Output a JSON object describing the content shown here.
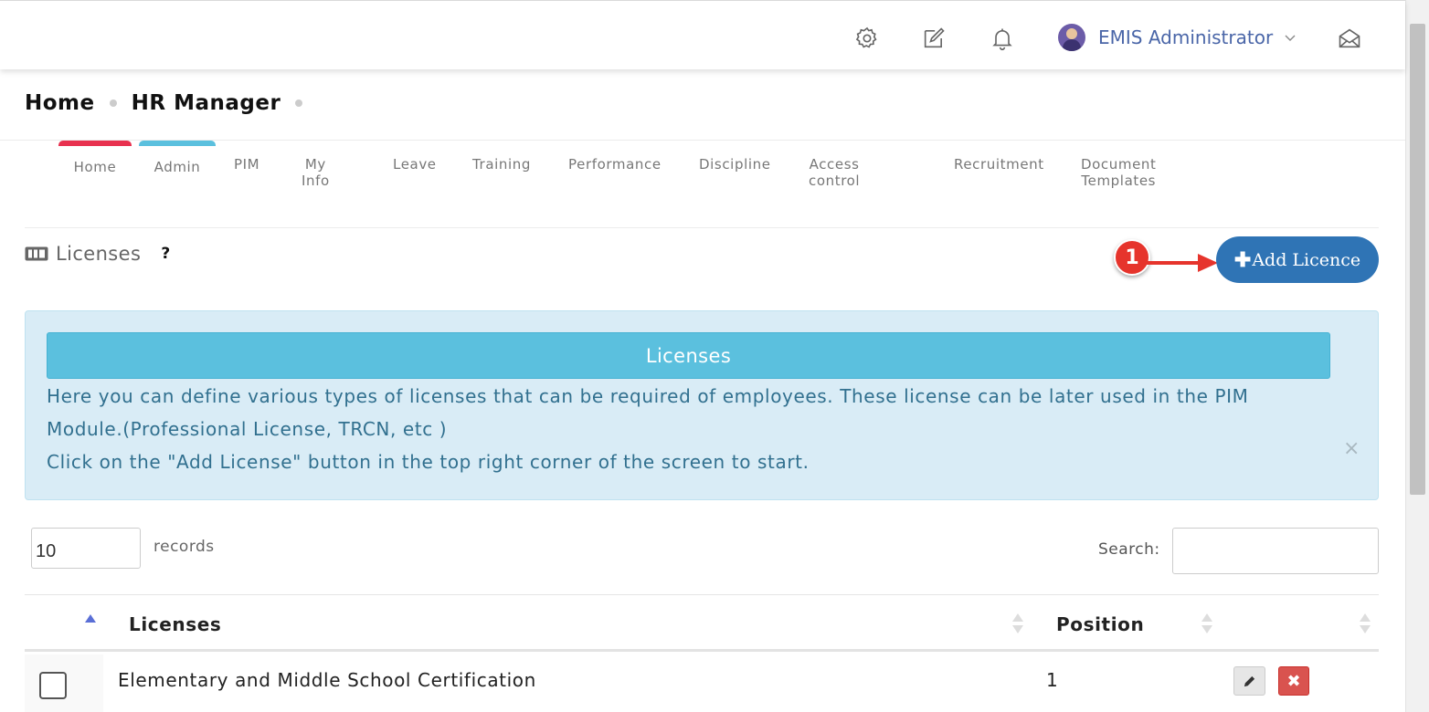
{
  "header": {
    "user_name": "EMIS Administrator"
  },
  "breadcrumb": {
    "home": "Home",
    "module": "HR Manager"
  },
  "tabs": [
    {
      "label": "Home",
      "accent": "#e8314f"
    },
    {
      "label": "Admin",
      "accent": "#5bc0de"
    },
    {
      "label": "PIM"
    },
    {
      "label": "My Info"
    },
    {
      "label": "Leave"
    },
    {
      "label": "Training"
    },
    {
      "label": "Performance"
    },
    {
      "label": "Discipline"
    },
    {
      "label": "Access control"
    },
    {
      "label": "Recruitment"
    },
    {
      "label": "Document Templates"
    }
  ],
  "page": {
    "title": "Licenses",
    "help": "?",
    "add_button": "Add Licence",
    "annotation_number": "1"
  },
  "alert": {
    "title": "Licenses",
    "line1": "Here you can define various types of licenses that can be required of employees. These license can be later used in the PIM Module.(Professional License, TRCN, etc )",
    "line2": "Click on the \"Add License\" button in the top right corner of the screen to start.",
    "close": "×"
  },
  "table_controls": {
    "page_length": "10",
    "records_label": "records",
    "search_label": "Search:",
    "search_value": ""
  },
  "table": {
    "columns": [
      "Licenses",
      "Position"
    ],
    "rows": [
      {
        "name": "Elementary and Middle School Certification",
        "position": "1"
      }
    ]
  },
  "colors": {
    "primary": "#2f74b5",
    "info": "#5bc0de",
    "danger": "#d9534f",
    "annotation": "#e6342c"
  }
}
